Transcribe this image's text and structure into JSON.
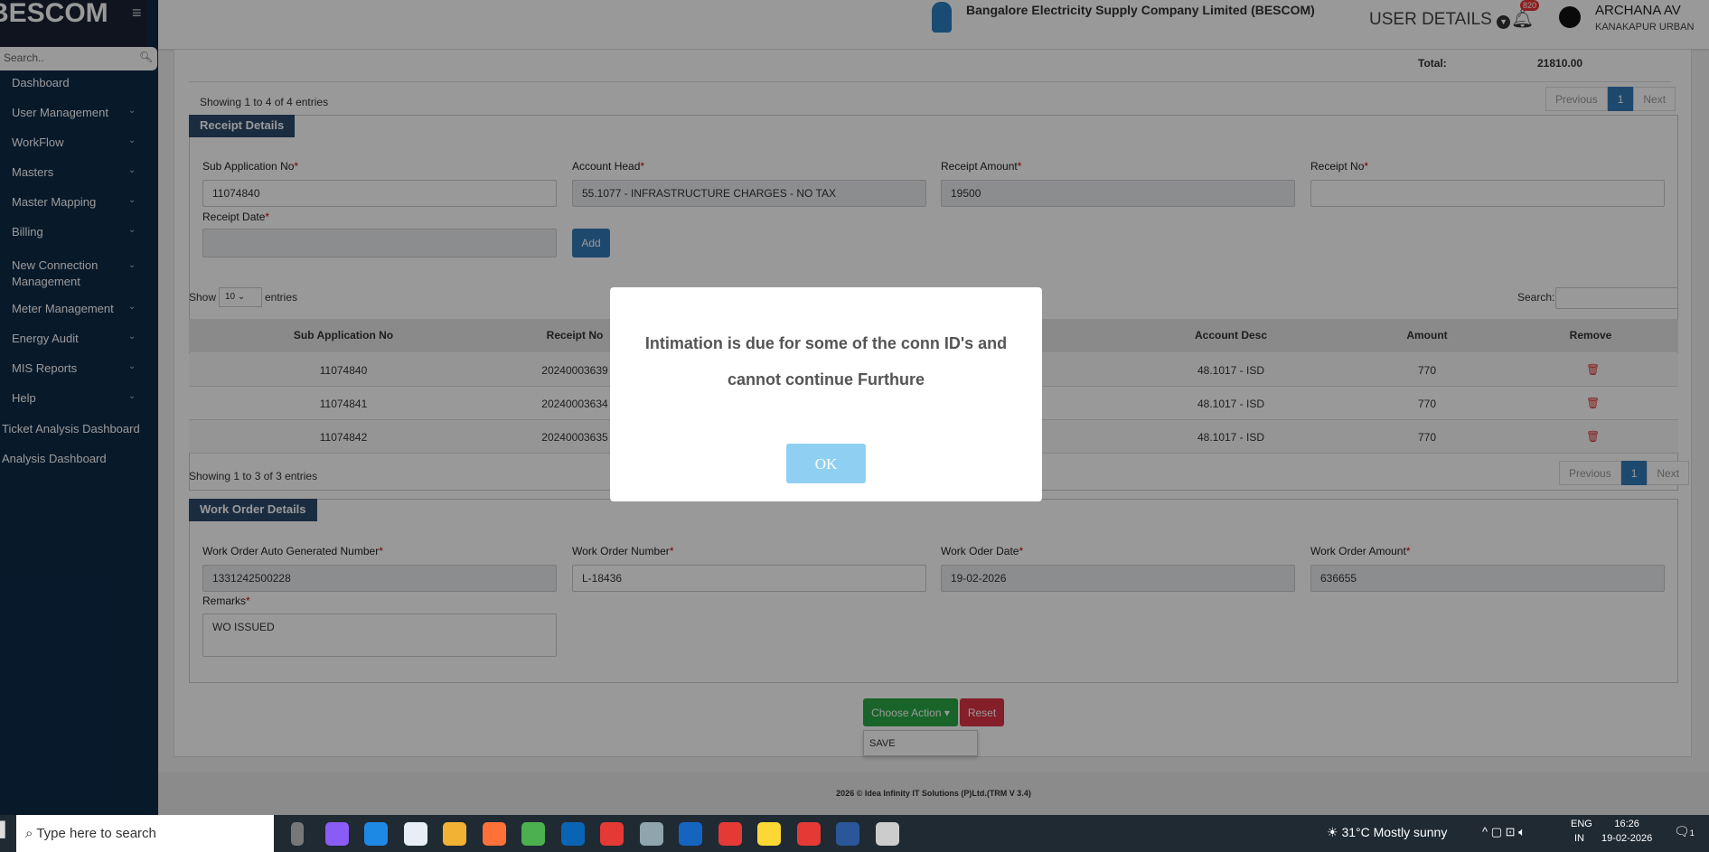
{
  "brand": "BESCOM",
  "sidebar": {
    "search_placeholder": "Search..",
    "items": [
      {
        "label": "Dashboard",
        "chev": false
      },
      {
        "label": "User Management",
        "chev": true
      },
      {
        "label": "WorkFlow",
        "chev": true
      },
      {
        "label": "Masters",
        "chev": true
      },
      {
        "label": "Master Mapping",
        "chev": true
      },
      {
        "label": "Billing",
        "chev": true
      },
      {
        "label": "New Connection Management",
        "chev": true
      },
      {
        "label": "Meter Management",
        "chev": true
      },
      {
        "label": "Energy Audit",
        "chev": true
      },
      {
        "label": "MIS Reports",
        "chev": true
      },
      {
        "label": "Help",
        "chev": true
      },
      {
        "label": "Ticket Analysis Dashboard",
        "chev": false
      },
      {
        "label": "Analysis Dashboard",
        "chev": false
      }
    ]
  },
  "header": {
    "company": "Bangalore Electricity Supply Company Limited (BESCOM)",
    "user_details": "USER DETAILS",
    "notif_count": "820",
    "user_name": "ARCHANA AV",
    "user_location": "KANAKAPUR URBAN"
  },
  "top": {
    "total_label": "Total:",
    "total_value": "21810.00",
    "showing": "Showing 1 to 4 of 4 entries",
    "prev": "Previous",
    "page": "1",
    "next": "Next"
  },
  "receipt": {
    "legend": "Receipt Details",
    "sub_app_label": "Sub Application No",
    "sub_app_value": "11074840",
    "account_head_label": "Account Head",
    "account_head_value": "55.1077 - INFRASTRUCTURE CHARGES - NO TAX",
    "amount_label": "Receipt Amount",
    "amount_value": "19500",
    "receipt_no_label": "Receipt No",
    "receipt_no_value": "",
    "date_label": "Receipt Date",
    "add": "Add"
  },
  "table": {
    "show": "Show",
    "page_size": "10",
    "entries": "entries",
    "search_label": "Search:",
    "headers": [
      "Sub Application No",
      "Receipt No",
      "Account Desc",
      "Amount",
      "Remove"
    ],
    "rows": [
      [
        "11074840",
        "20240003639",
        "48.1017 - ISD",
        "770"
      ],
      [
        "11074841",
        "20240003634",
        "48.1017 - ISD",
        "770"
      ],
      [
        "11074842",
        "20240003635",
        "48.1017 - ISD",
        "770"
      ]
    ],
    "showing": "Showing 1 to 3 of 3 entries",
    "prev": "Previous",
    "page": "1",
    "next": "Next"
  },
  "work_order": {
    "legend": "Work Order Details",
    "auto_label": "Work Order Auto Generated Number",
    "auto_value": "1331242500228",
    "number_label": "Work Order Number",
    "number_value": "L-18436",
    "date_label": "Work Oder Date",
    "date_value": "19-02-2026",
    "amount_label": "Work Order Amount",
    "amount_value": "636655",
    "remarks_label": "Remarks",
    "remarks_value": "WO ISSUED"
  },
  "actions": {
    "choose": "Choose Action",
    "reset": "Reset",
    "menu": [
      "SAVE"
    ]
  },
  "footer": "2026 © Idea Infinity IT Solutions (P)Ltd.(TRM V 3.4)",
  "modal": {
    "message": "Intimation is due for some of the conn ID's and cannot continue Furthure",
    "ok": "OK"
  },
  "taskbar": {
    "search": "Type here to search",
    "weather": "31°C  Mostly sunny",
    "lang1": "ENG",
    "lang2": "IN",
    "time": "16:26",
    "date": "19-02-2026",
    "notif": "1"
  },
  "colors": {
    "sidebar": "#0e2a47",
    "legend": "#2c4a6b",
    "primary": "#337ab7",
    "success": "#28a745",
    "danger": "#dc3545",
    "ok": "#8fd0f2"
  }
}
